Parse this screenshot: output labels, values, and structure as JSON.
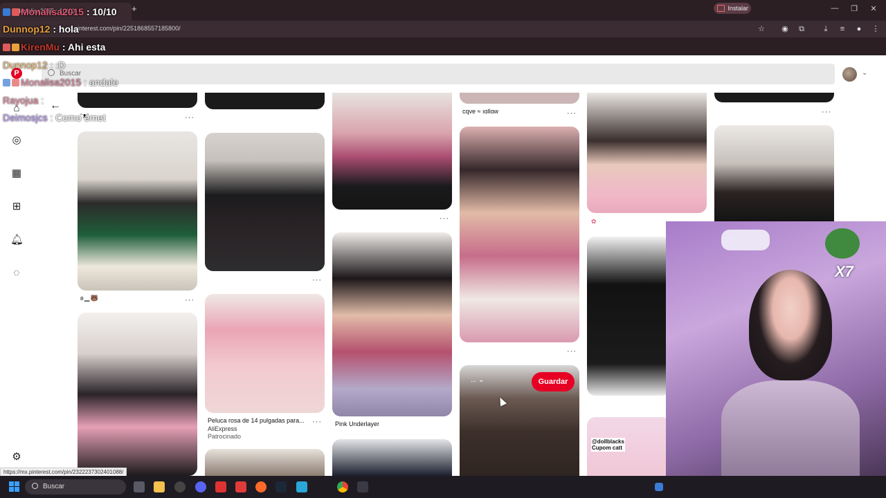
{
  "browser": {
    "tab_title": "Monalisa2015 : 10/10",
    "tab_plus": "+",
    "url": "c.pinterest.com/pin/2251868557185800/",
    "install_label": "Instalar",
    "status_url": "https://mx.pinterest.com/pin/2322237302401088/",
    "window_controls": [
      "—",
      "❐",
      "✕"
    ]
  },
  "chat": [
    {
      "user": "Monalisa2015",
      "message": ": 10/10"
    },
    {
      "user": "Dunnop12",
      "message": ": hola"
    },
    {
      "user": "KirenMu",
      "message": ": Ahi esta"
    },
    {
      "user": "Dunnop12",
      "message": ": :D"
    },
    {
      "user": "Monalisa2015",
      "message": ": andale"
    },
    {
      "user": "Rayojua",
      "message": ":"
    },
    {
      "user": "Deimosjcs",
      "message": ": Como emet"
    }
  ],
  "pinterest": {
    "search_placeholder": "Buscar",
    "logo_letter": "P",
    "sidebar_icons": [
      "home-icon",
      "compass-icon",
      "board-icon",
      "plus-icon",
      "bell-icon",
      "chat-icon",
      "settings-icon"
    ],
    "pins": {
      "caption_top_col4": "cqve ≈ ıɑllɑw",
      "caption_row1_col1": "ʚ ̳ ̳ ̳ 🐻",
      "caption_wig_title": "Peluca rosa de 14 pulgadas para...",
      "caption_wig_source": "AliExpress",
      "caption_wig_sponsored": "Patrocinado",
      "caption_pink_underlayer": "Pink Underlayer",
      "caption_small_top_col1": "ᵔᴥᵔ",
      "save_button": "Guardar",
      "dropdown_chip": "... ⌄",
      "dollblacks_text": "@dollblacks\nCupom catt"
    }
  },
  "webcam": {
    "overlay_text": "X7"
  },
  "taskbar": {
    "search_label": "Buscar"
  },
  "colors": {
    "pinterest_red": "#e60023",
    "chrome_dark": "#2b1f24",
    "taskbar": "#1f1b22"
  }
}
